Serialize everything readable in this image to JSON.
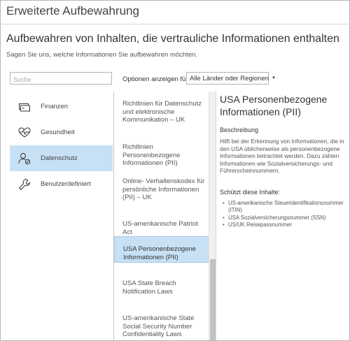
{
  "window": {
    "title": "Erweiterte Aufbewahrung"
  },
  "page": {
    "heading": "Aufbewahren von Inhalten, die vertrauliche Informationen enthalten",
    "subheading": "Sagen Sie uns, welche Informationen Sie aufbewahren möchten."
  },
  "search": {
    "placeholder": "Suche",
    "value": ""
  },
  "filter": {
    "label": "Optionen anzeigen für",
    "selected": "Alle Länder oder Regionen"
  },
  "categories": [
    {
      "label": "Finanzen",
      "icon": "money-icon",
      "selected": false
    },
    {
      "label": "Gesundheit",
      "icon": "heart-pulse-icon",
      "selected": false
    },
    {
      "label": "Datenschutz",
      "icon": "privacy-icon",
      "selected": true
    },
    {
      "label": "Benutzerdefiniert",
      "icon": "wrench-icon",
      "selected": false
    }
  ],
  "templates": [
    {
      "label": "Richtlinien für Datenschutz und elektronische Kommunikation – UK",
      "selected": false
    },
    {
      "label": "Richtlinien Personenbezogene Informationen (PII)",
      "selected": false
    },
    {
      "label": "Online- Verhaltenskodex für persönliche Informationen (PII) – UK",
      "selected": false
    },
    {
      "label": "US-amerikanische Patriot Act",
      "selected": false
    },
    {
      "label": "USA Personenbezogene Informationen (PII)",
      "selected": true
    },
    {
      "label": "USA State Breach Notification Laws",
      "selected": false
    },
    {
      "label": "US-amerikanische State Social Security Number Confidentiality Laws",
      "selected": false
    }
  ],
  "detail": {
    "title": "USA Personenbezogene Informationen (PII)",
    "description_heading": "Beschreibung",
    "description": "Hilft bei der Erkennung von Informationen, die in den USA üblicherweise als personenbezogene Informationen betrachtet werden. Dazu zählen Informationen wie Sozialversicherungs- und Führerscheinnummern.",
    "protects_heading": "Schützt diese Inhalte:",
    "protects": [
      "US-amerikanische Steueridentifikationsnummer (ITIN)",
      "USA Sozialversicherungsnummer (SSN)",
      "US/UK Reisepassnummer"
    ]
  },
  "colors": {
    "selection_background": "#c7e0f4",
    "icon_color": "#333333"
  }
}
